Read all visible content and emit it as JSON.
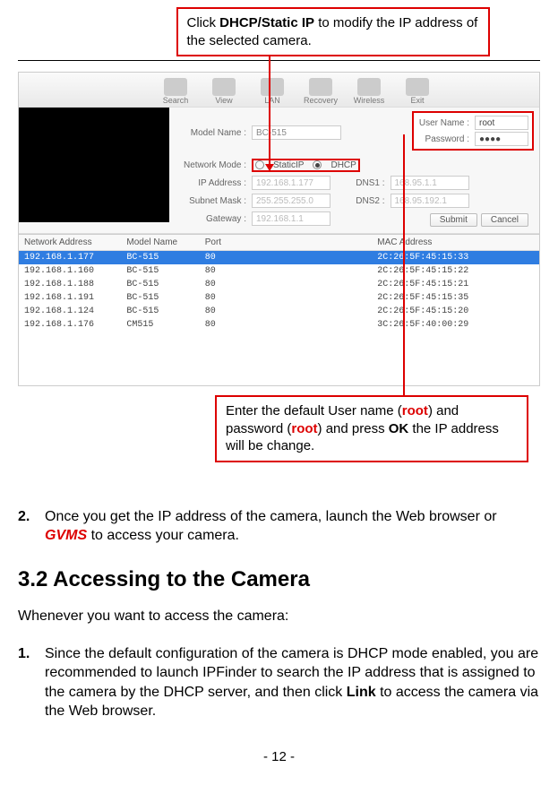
{
  "callouts": {
    "top_prefix": "Click ",
    "top_bold": "DHCP/Static IP",
    "top_suffix": " to modify the IP address of the selected camera.",
    "bottom_prefix": "Enter the default User name (",
    "bottom_root1": "root",
    "bottom_mid": ") and password (",
    "bottom_root2": "root",
    "bottom_mid2": ") and press ",
    "bottom_ok": "OK",
    "bottom_suffix": " the IP address will be change."
  },
  "toolbar": {
    "items": [
      "Search",
      "View",
      "LAN",
      "Recovery",
      "Wireless",
      "Exit"
    ]
  },
  "form": {
    "model_name_label": "Model Name :",
    "model_name_value": "BC-515",
    "user_name_label": "User Name :",
    "user_name_value": "root",
    "password_label": "Password :",
    "password_value": "●●●●",
    "network_mode_label": "Network Mode :",
    "static_ip_label": "StaticIP",
    "dhcp_label": "DHCP",
    "ip_address_label": "IP Address :",
    "ip_address_value": "192.168.1.177",
    "subnet_label": "Subnet Mask :",
    "subnet_value": "255.255.255.0",
    "gateway_label": "Gateway :",
    "gateway_value": "192.168.1.1",
    "dns1_label": "DNS1 :",
    "dns1_value": "168.95.1.1",
    "dns2_label": "DNS2 :",
    "dns2_value": "168.95.192.1",
    "submit": "Submit",
    "cancel": "Cancel"
  },
  "table": {
    "headers": {
      "addr": "Network Address",
      "model": "Model Name",
      "port": "Port",
      "mac": "MAC Address"
    },
    "rows": [
      {
        "addr": "192.168.1.177",
        "model": "BC-515",
        "port": "80",
        "mac": "2C:26:5F:45:15:33",
        "sel": true
      },
      {
        "addr": "192.168.1.160",
        "model": "BC-515",
        "port": "80",
        "mac": "2C:26:5F:45:15:22",
        "sel": false
      },
      {
        "addr": "192.168.1.188",
        "model": "BC-515",
        "port": "80",
        "mac": "2C:26:5F:45:15:21",
        "sel": false
      },
      {
        "addr": "192.168.1.191",
        "model": "BC-515",
        "port": "80",
        "mac": "2C:26:5F:45:15:35",
        "sel": false
      },
      {
        "addr": "192.168.1.124",
        "model": "BC-515",
        "port": "80",
        "mac": "2C:26:5F:45:15:20",
        "sel": false
      },
      {
        "addr": "192.168.1.176",
        "model": "CM515",
        "port": "80",
        "mac": "3C:26:5F:40:00:29",
        "sel": false
      }
    ]
  },
  "body": {
    "step2_num": "2.",
    "step2_a": "Once you get the IP address of the camera, launch the Web browser or ",
    "step2_gvms": "GVMS",
    "step2_b": " to access your camera.",
    "h3": "3.2  Accessing to the Camera",
    "para1": "Whenever you want to access the camera:",
    "step1_num": "1.",
    "step1_a": "Since the default configuration of the camera is DHCP mode enabled, you are recommended to launch IPFinder to search the IP address that is assigned to the camera by the DHCP server, and then click ",
    "step1_link": "Link",
    "step1_b": " to access the camera via the Web browser.",
    "page_num": "- 12 -"
  }
}
